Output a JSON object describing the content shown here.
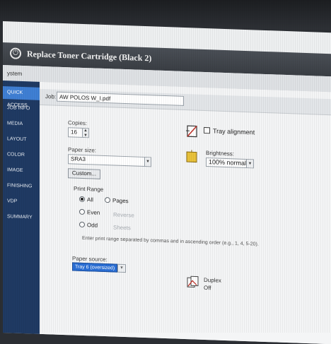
{
  "window": {
    "title": "Replace Toner Cartridge (Black 2)"
  },
  "menubar": {
    "label": "ystem"
  },
  "sidebar": {
    "items": [
      {
        "label": "QUICK ACCESS",
        "active": true
      },
      {
        "label": "JOB INFO",
        "active": false
      },
      {
        "label": "MEDIA",
        "active": false
      },
      {
        "label": "LAYOUT",
        "active": false
      },
      {
        "label": "COLOR",
        "active": false
      },
      {
        "label": "IMAGE",
        "active": false
      },
      {
        "label": "FINISHING",
        "active": false
      },
      {
        "label": "VDP",
        "active": false
      },
      {
        "label": "SUMMARY",
        "active": false
      }
    ]
  },
  "job": {
    "label": "Job:",
    "value": "AW POLOS W_I.pdf"
  },
  "copies": {
    "label": "Copies:",
    "value": "16"
  },
  "paper_size": {
    "label": "Paper size:",
    "value": "SRA3",
    "custom_button": "Custom..."
  },
  "print_range": {
    "title": "Print Range",
    "all": "All",
    "pages": "Pages",
    "even": "Even",
    "odd": "Odd",
    "reverse": "Reverse",
    "sheets": "Sheets",
    "selected": "all",
    "hint": "Enter print range separated by commas and in ascending order (e.g., 1, 4, 5-20)."
  },
  "paper_source": {
    "label": "Paper source:",
    "value": "Tray 6 (oversized)"
  },
  "tray_alignment": {
    "label": "Tray alignment",
    "checked": false
  },
  "brightness": {
    "label": "Brightness:",
    "value": "100% normal"
  },
  "duplex": {
    "label": "Duplex",
    "value": "Off"
  },
  "colors": {
    "accent": "#3f7fd4",
    "sidebar": "#1f3a63",
    "selection": "#2a6fd6"
  }
}
